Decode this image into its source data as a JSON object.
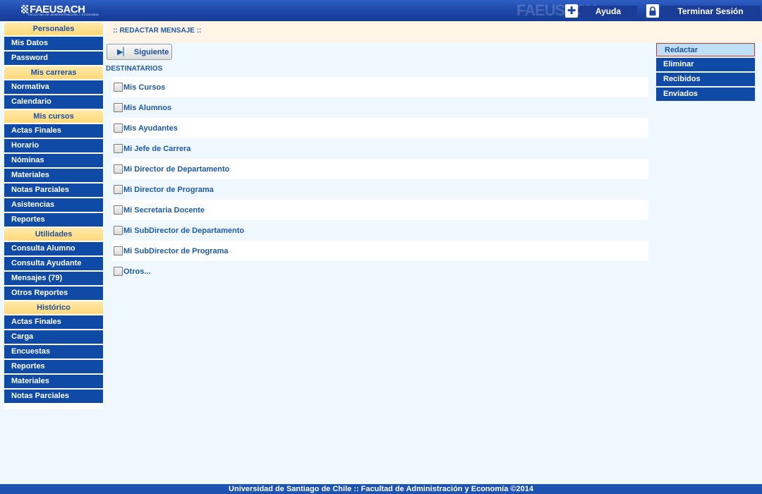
{
  "header": {
    "logo_text": "FAEUSACH",
    "logo_subtitle": "FACULTAD DE ADMINISTRACIÓN Y ECONOMÍA",
    "help_icon": "plus-medical-icon",
    "help_label": "Ayuda",
    "logout_icon": "lock-icon",
    "logout_label": "Terminar Sesión"
  },
  "sidebar": {
    "sections": [
      {
        "title": "Personales",
        "items": [
          "Mis Datos",
          "Password"
        ]
      },
      {
        "title": "Mis carreras",
        "items": [
          "Normativa",
          "Calendario"
        ]
      },
      {
        "title": "Mis cursos",
        "items": [
          "Actas Finales",
          "Horario",
          "Nóminas",
          "Materiales",
          "Notas Parciales",
          "Asistencias",
          "Reportes"
        ]
      },
      {
        "title": "Utilidades",
        "items": [
          "Consulta Alumno",
          "Consulta Ayudante",
          "Mensajes (79)",
          "Otros Reportes"
        ]
      },
      {
        "title": "Histórico",
        "items": [
          "Actas Finales",
          "Carga",
          "Encuestas",
          "Reportes",
          "Materiales",
          "Notas Parciales"
        ]
      }
    ]
  },
  "content": {
    "section_title": ":: REDACTAR MENSAJE ::",
    "next_button_label": "Siguiente",
    "recipients_label": "DESTINATARIOS",
    "recipients": [
      "Mis Cursos",
      "Mis Alumnos",
      "Mis Ayudantes",
      "Mi Jefe de Carrera",
      "Mi Director de Departamento",
      "Mi Director de Programa",
      "Mi Secretaria Docente",
      "Mi SubDirector de Departamento",
      "Mi SubDirector de Programa",
      "Otros..."
    ]
  },
  "right_menu": {
    "items": [
      {
        "label": "Redactar",
        "active": true
      },
      {
        "label": "Eliminar",
        "active": false
      },
      {
        "label": "Recibidos",
        "active": false
      },
      {
        "label": "Enviados",
        "active": false
      }
    ]
  },
  "footer": {
    "text": "Universidad de Santiago de Chile :: Facultad de Administración y Economía ©2014"
  },
  "colors": {
    "header_blue": "#1d47a8",
    "menu_blue": "#0f4aa6",
    "section_yellow": "#ffd97a",
    "link_blue": "#1d5aa6",
    "active_border": "#c0392b"
  }
}
